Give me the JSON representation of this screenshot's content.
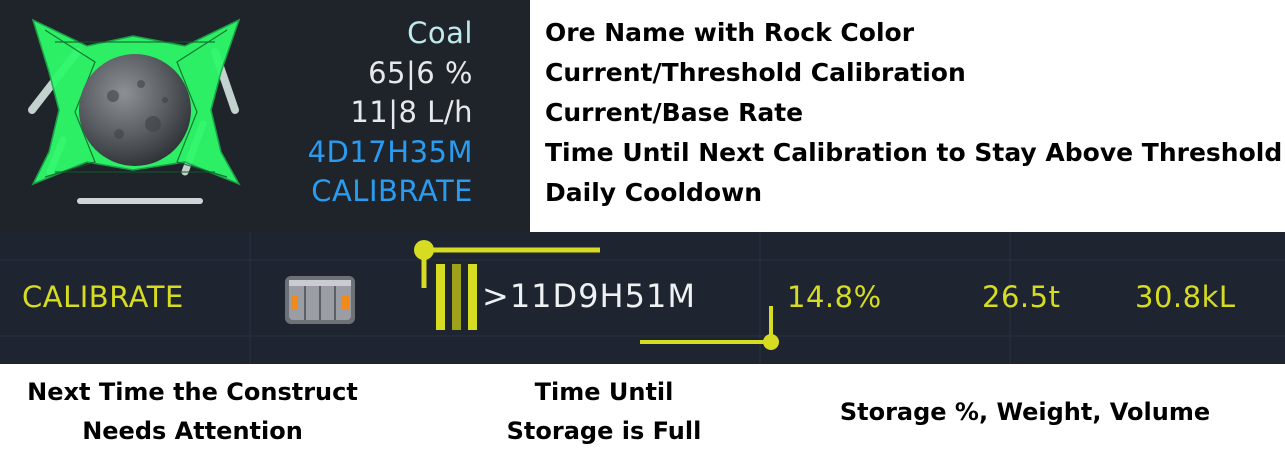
{
  "ore_panel": {
    "ore_name": "Coal",
    "calibration": "65|6 %",
    "rate": "11|8 L/h",
    "countdown": "4D17H35M",
    "action": "CALIBRATE",
    "colors": {
      "ore_name": "#bfe9ea",
      "value": "#e6e8ea",
      "accent": "#2a9cf0",
      "frame": "#2dfa6a"
    },
    "icons": [
      "ore-rock-icon",
      "green-frame-icon"
    ]
  },
  "legend": {
    "items": [
      "Ore Name with Rock Color",
      "Current/Threshold Calibration",
      "Current/Base Rate",
      "Time Until Next Calibration to Stay Above Threshold",
      "Daily Cooldown"
    ]
  },
  "status_bar": {
    "next_attention": "CALIBRATE",
    "time_until_full": ">11D9H51M",
    "storage_percent": "14.8%",
    "storage_weight": "26.5t",
    "storage_volume": "30.8kL",
    "colors": {
      "accent": "#d6dc22",
      "time": "#eef0f2",
      "background": "#1e2430"
    },
    "icons": [
      "container-icon",
      "storage-level-icon"
    ]
  },
  "captions": {
    "next_attention": [
      "Next Time the Construct",
      "Needs Attention"
    ],
    "time_until_full": [
      "Time Until",
      "Storage is Full"
    ],
    "storage": "Storage %, Weight, Volume"
  }
}
